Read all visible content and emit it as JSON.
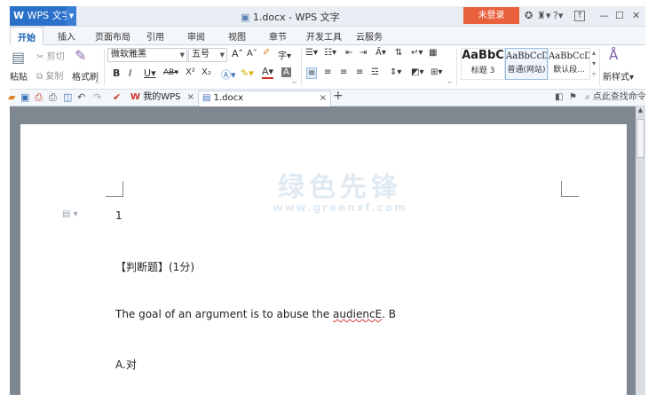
{
  "titlebar": {
    "app_name": "WPS 文字",
    "app_icon": "wps-w-logo",
    "document_title": "1.docx - WPS 文字",
    "login_button": "未登录",
    "help_label": "?",
    "minimize": "—",
    "maximize": "☐",
    "close": "✕"
  },
  "ribbon_tabs": [
    "开始",
    "插入",
    "页面布局",
    "引用",
    "审阅",
    "视图",
    "章节",
    "开发工具",
    "云服务"
  ],
  "ribbon": {
    "paste": "粘贴",
    "cut": "剪切",
    "copy": "复制",
    "format_painter": "格式刷",
    "font_name": "微软雅黑",
    "font_size": "五号",
    "grow_font": "A",
    "shrink_font": "A",
    "bold": "B",
    "italic": "I",
    "underline": "U",
    "strikethrough": "AB",
    "superscript": "X²",
    "subscript": "X₂",
    "font_color": "A",
    "styles": [
      {
        "sample": "AaBbC",
        "name": "标题 3"
      },
      {
        "sample": "AaBbCcD",
        "name": "普通(网站)"
      },
      {
        "sample": "AaBbCcDc",
        "name": "默认段..."
      }
    ],
    "new_style": "新样式"
  },
  "quick_bar": {
    "doc_tabs": [
      {
        "label": "我的WPS",
        "close": "×"
      },
      {
        "label": "1.docx",
        "close": "×"
      }
    ],
    "new_tab": "+",
    "search_label": "点此查找命令"
  },
  "document": {
    "watermark_main": "绿色先锋",
    "watermark_sub": "www.greenxf.com",
    "lines": [
      {
        "text": "1"
      },
      {
        "text": "【判断题】(1分)"
      },
      {
        "prefix": "The goal of an argument is to abuse the ",
        "misspelled": "audiencE",
        "suffix": ". B"
      },
      {
        "text": "A.对"
      }
    ]
  },
  "colors": {
    "accent_blue": "#2b70c9",
    "login_orange": "#e8613c",
    "workspace_gray": "#7f8790",
    "spellcheck_red": "#d23a3a"
  }
}
